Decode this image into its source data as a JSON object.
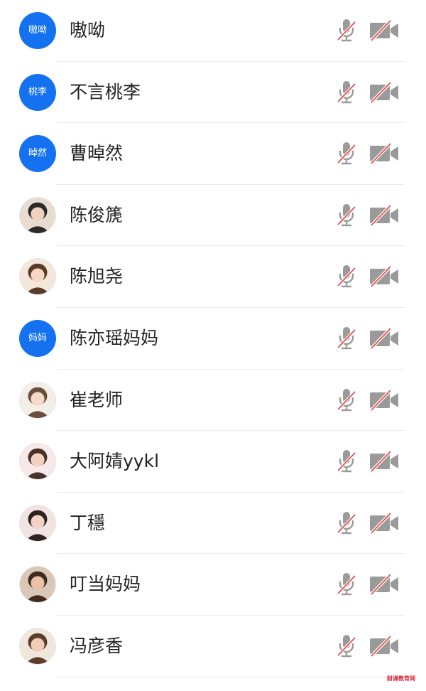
{
  "participants": [
    {
      "name": "嗷呦",
      "avatar_type": "text",
      "avatar_text": "嗷呦",
      "mic": "muted",
      "camera": "off"
    },
    {
      "name": "不言桃李",
      "avatar_type": "text",
      "avatar_text": "桃李",
      "mic": "muted",
      "camera": "off"
    },
    {
      "name": "曹晫然",
      "avatar_type": "text",
      "avatar_text": "晫然",
      "mic": "muted",
      "camera": "off"
    },
    {
      "name": "陈俊篪",
      "avatar_type": "photo",
      "avatar_text": "",
      "mic": "muted",
      "camera": "off"
    },
    {
      "name": "陈旭尧",
      "avatar_type": "photo",
      "avatar_text": "",
      "mic": "muted",
      "camera": "off"
    },
    {
      "name": "陈亦瑶妈妈",
      "avatar_type": "text",
      "avatar_text": "妈妈",
      "mic": "muted",
      "camera": "off"
    },
    {
      "name": "崔老师",
      "avatar_type": "photo",
      "avatar_text": "",
      "mic": "muted",
      "camera": "off"
    },
    {
      "name": "大阿婧yykl",
      "avatar_type": "photo",
      "avatar_text": "",
      "mic": "muted",
      "camera": "off"
    },
    {
      "name": "丁穩",
      "avatar_type": "photo",
      "avatar_text": "",
      "mic": "muted",
      "camera": "off"
    },
    {
      "name": "叮当妈妈",
      "avatar_type": "photo",
      "avatar_text": "",
      "mic": "muted",
      "camera": "off"
    },
    {
      "name": "冯彦香",
      "avatar_type": "photo",
      "avatar_text": "",
      "mic": "muted",
      "camera": "off"
    }
  ],
  "colors": {
    "avatar_blue": "#1472f0",
    "icon_gray": "#9a9a9a",
    "mute_slash": "#e0524f"
  },
  "watermark_text": "财课教育网"
}
